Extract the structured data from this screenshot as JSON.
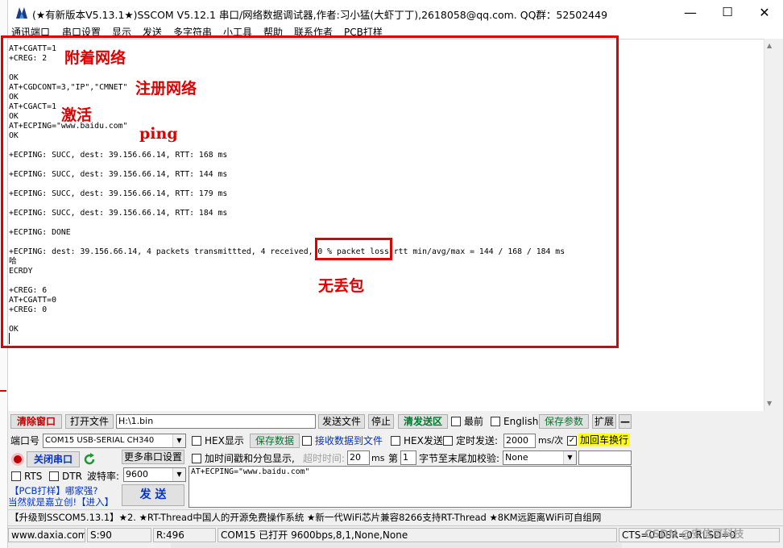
{
  "window": {
    "title": "(★有新版本V5.13.1★)SSCOM V5.12.1 串口/网络数据调试器,作者:习小猛(大虾丁丁),2618058@qq.com. QQ群：52502449",
    "minimize": "—",
    "maximize": "☐",
    "close": "✕"
  },
  "menu": [
    "通讯端口",
    "串口设置",
    "显示",
    "发送",
    "多字符串",
    "小工具",
    "帮助",
    "联系作者",
    "PCB打样"
  ],
  "terminal": {
    "lines": [
      "AT+CGATT=1",
      "+CREG: 2",
      "",
      "OK",
      "AT+CGDCONT=3,\"IP\",\"CMNET\"",
      "OK",
      "AT+CGACT=1",
      "OK",
      "AT+ECPING=\"www.baidu.com\"",
      "OK",
      "",
      "+ECPING: SUCC, dest: 39.156.66.14, RTT: 168 ms",
      "",
      "+ECPING: SUCC, dest: 39.156.66.14, RTT: 144 ms",
      "",
      "+ECPING: SUCC, dest: 39.156.66.14, RTT: 179 ms",
      "",
      "+ECPING: SUCC, dest: 39.156.66.14, RTT: 184 ms",
      "",
      "+ECPING: DONE",
      "",
      "+ECPING: dest: 39.156.66.14, 4 packets transmittted, 4 received, 0 % packet loss rtt min/avg/max = 144 / 168 / 184 ms",
      "哈",
      "ECRDY",
      "",
      "+CREG: 6",
      "AT+CGATT=0",
      "+CREG: 0",
      "",
      "OK"
    ]
  },
  "annotations": {
    "attach": "附着网络",
    "register": "注册网络",
    "activate": "激活",
    "ping": "ping",
    "no_loss": "无丢包"
  },
  "toolbar1": {
    "clear_window": "清除窗口",
    "open_file": "打开文件",
    "file_path": "H:\\1.bin",
    "send_file": "发送文件",
    "stop": "停止",
    "clear_send": "清发送区",
    "topmost": "最前",
    "english": "English",
    "save_params": "保存参数",
    "expand": "扩展",
    "collapse": "—"
  },
  "port": {
    "port_label": "端口号",
    "port_value": "COM15 USB-SERIAL CH340",
    "close_port": "关闭串口",
    "more_settings": "更多串口设置",
    "rts": "RTS",
    "dtr": "DTR",
    "baud_label": "波特率:",
    "baud_value": "9600"
  },
  "options": {
    "hex_display": "HEX显示",
    "save_data": "保存数据",
    "recv_to_file": "接收数据到文件",
    "hex_send": "HEX发送",
    "timed_send": "定时发送:",
    "interval": "2000",
    "interval_unit": "ms/次",
    "add_crlf": "加回车换行",
    "timestamp": "加时间戳和分包显示,",
    "timeout_label": "超时时间:",
    "timeout_value": "20",
    "timeout_unit": "ms",
    "byte_prefix": "第",
    "byte_index": "1",
    "byte_suffix": "字节至末尾加校验:",
    "checksum": "None"
  },
  "send": {
    "input_text": "AT+ECPING=\"www.baidu.com\"",
    "send_button": "发  送",
    "promo1": "【PCB打样】哪家强?",
    "promo2": "当然就是嘉立创!【进入】"
  },
  "banner": "【升级到SSCOM5.13.1】★2. ★RT-Thread中国人的开源免费操作系统 ★新一代WiFi芯片兼容8266支持RT-Thread ★8KM远距离WiFi可自组网",
  "status": {
    "site": "www.daxia.com",
    "sent": "S:90",
    "received": "R:496",
    "port_state": "COM15 已打开  9600bps,8,1,None,None",
    "lines": "CTS=0 DSR=0 RLSD=0"
  },
  "watermark": "CSDN @安信可科技",
  "colors": {
    "annotation_red": "#e00000",
    "green_text": "#00792d",
    "highlight_yellow": "#ffff00"
  }
}
